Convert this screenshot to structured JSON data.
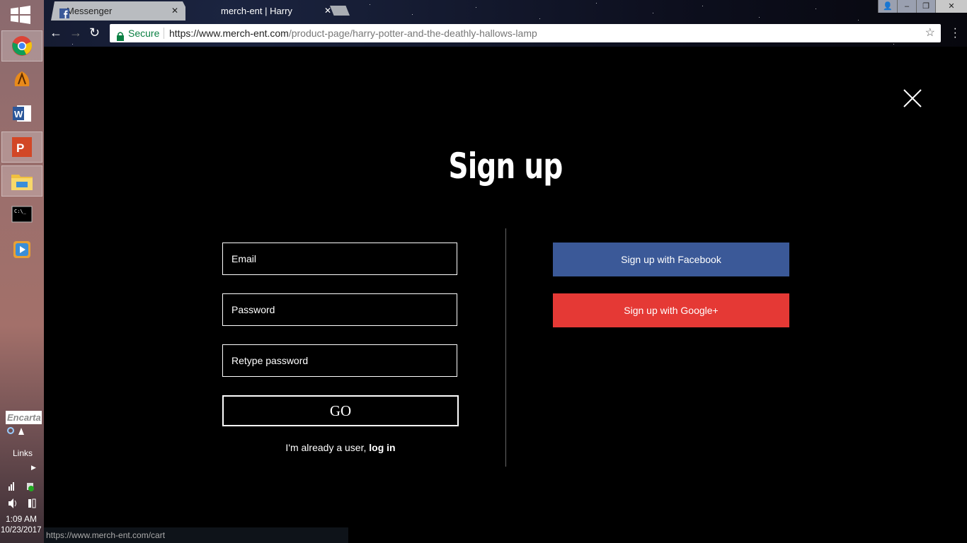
{
  "taskbar": {
    "apps": [
      {
        "name": "chrome"
      },
      {
        "name": "winamp"
      },
      {
        "name": "word"
      },
      {
        "name": "powerpoint"
      },
      {
        "name": "file-explorer"
      },
      {
        "name": "command-prompt"
      },
      {
        "name": "media-player"
      }
    ],
    "search_text": "Encarta",
    "links_label": "Links",
    "time": "1:09 AM",
    "date": "10/23/2017"
  },
  "browser": {
    "tabs": [
      {
        "label": "Messenger",
        "icon": "facebook-icon"
      },
      {
        "label": "merch-ent | Harry Potter"
      }
    ],
    "secure_label": "Secure",
    "url_host": "https://www.merch-ent.com",
    "url_path": "/product-page/harry-potter-and-the-deathly-hallows-lamp",
    "status_url": "https://www.merch-ent.com/cart"
  },
  "signup": {
    "title": "Sign up",
    "email_placeholder": "Email",
    "password_placeholder": "Password",
    "retype_placeholder": "Retype password",
    "go_label": "GO",
    "already_text": "I'm already a user, ",
    "login_link": "log in",
    "facebook_label": "Sign up with Facebook",
    "google_label": "Sign up with Google+"
  },
  "colors": {
    "facebook": "#3b5998",
    "google": "#e53935",
    "secure_green": "#0b8043"
  }
}
